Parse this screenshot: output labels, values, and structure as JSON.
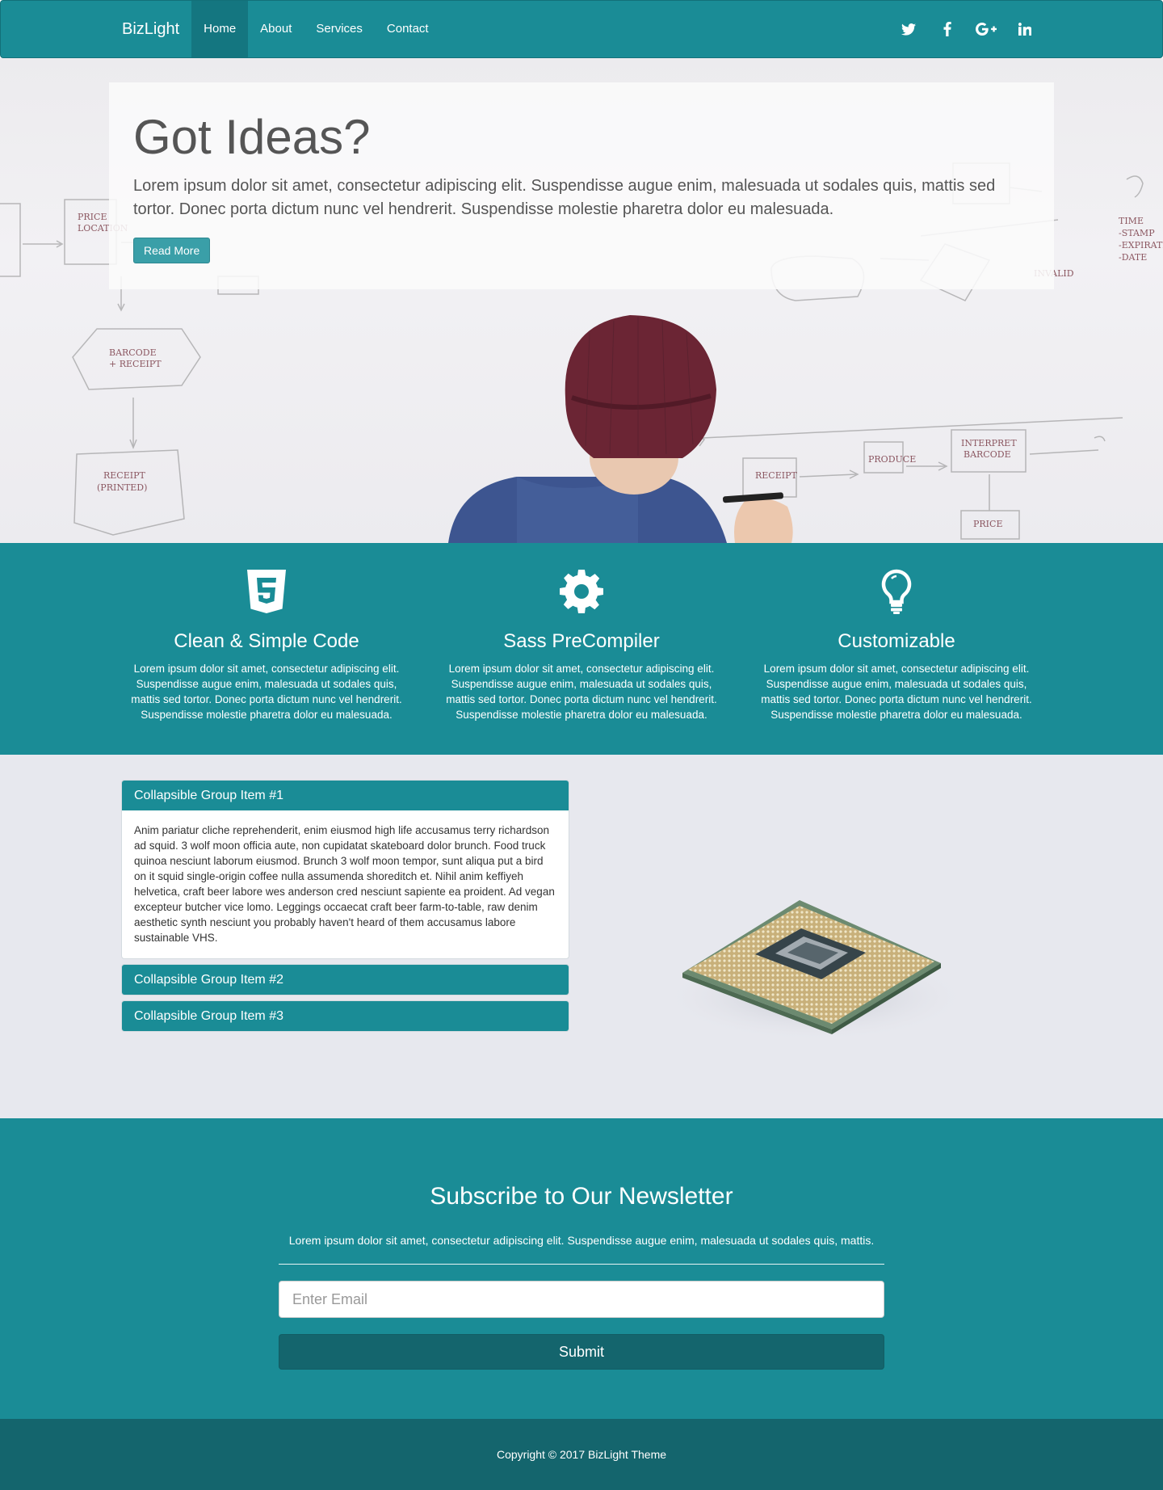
{
  "nav": {
    "brand": "BizLight",
    "links": [
      {
        "label": "Home",
        "active": true
      },
      {
        "label": "About",
        "active": false
      },
      {
        "label": "Services",
        "active": false
      },
      {
        "label": "Contact",
        "active": false
      }
    ],
    "social": [
      "twitter-icon",
      "facebook-icon",
      "google-plus-icon",
      "linkedin-icon"
    ]
  },
  "hero": {
    "title": "Got Ideas?",
    "text": "Lorem ipsum dolor sit amet, consectetur adipiscing elit. Suspendisse augue enim, malesuada ut sodales quis, mattis sed tortor. Donec porta dictum nunc vel hendrerit. Suspendisse molestie pharetra dolor eu malesuada.",
    "button": "Read More"
  },
  "features": [
    {
      "icon": "html5-icon",
      "title": "Clean & Simple Code",
      "text": "Lorem ipsum dolor sit amet, consectetur adipiscing elit. Suspendisse augue enim, malesuada ut sodales quis, mattis sed tortor. Donec porta dictum nunc vel hendrerit. Suspendisse molestie pharetra dolor eu malesuada."
    },
    {
      "icon": "gear-icon",
      "title": "Sass PreCompiler",
      "text": "Lorem ipsum dolor sit amet, consectetur adipiscing elit. Suspendisse augue enim, malesuada ut sodales quis, mattis sed tortor. Donec porta dictum nunc vel hendrerit. Suspendisse molestie pharetra dolor eu malesuada."
    },
    {
      "icon": "lightbulb-icon",
      "title": "Customizable",
      "text": "Lorem ipsum dolor sit amet, consectetur adipiscing elit. Suspendisse augue enim, malesuada ut sodales quis, mattis sed tortor. Donec porta dictum nunc vel hendrerit. Suspendisse molestie pharetra dolor eu malesuada."
    }
  ],
  "accordion": {
    "items": [
      {
        "title": "Collapsible Group Item #1",
        "expanded": true,
        "body": "Anim pariatur cliche reprehenderit, enim eiusmod high life accusamus terry richardson ad squid. 3 wolf moon officia aute, non cupidatat skateboard dolor brunch. Food truck quinoa nesciunt laborum eiusmod. Brunch 3 wolf moon tempor, sunt aliqua put a bird on it squid single-origin coffee nulla assumenda shoreditch et. Nihil anim keffiyeh helvetica, craft beer labore wes anderson cred nesciunt sapiente ea proident. Ad vegan excepteur butcher vice lomo. Leggings occaecat craft beer farm-to-table, raw denim aesthetic synth nesciunt you probably haven't heard of them accusamus labore sustainable VHS."
      },
      {
        "title": "Collapsible Group Item #2",
        "expanded": false
      },
      {
        "title": "Collapsible Group Item #3",
        "expanded": false
      }
    ]
  },
  "newsletter": {
    "title": "Subscribe to Our Newsletter",
    "text": "Lorem ipsum dolor sit amet, consectetur adipiscing elit. Suspendisse augue enim, malesuada ut sodales quis, mattis.",
    "placeholder": "Enter Email",
    "button": "Submit"
  },
  "footer": {
    "copyright": "Copyright © 2017 BizLight Theme"
  },
  "colors": {
    "primary": "#1a8c96",
    "dark": "#14656d",
    "section_bg": "#e7e8ee"
  }
}
